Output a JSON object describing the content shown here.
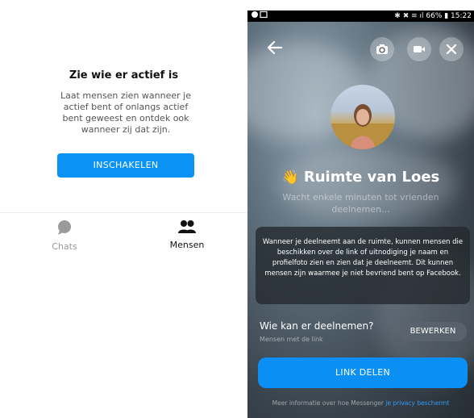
{
  "left_panel": {
    "title": "Zie wie er actief is",
    "description": "Laat mensen zien wanneer je actief bent of onlangs actief bent geweest en ontdek ook wanneer zij dat zijn.",
    "enable_button": "INSCHAKELEN",
    "tabs": [
      {
        "label": "Chats",
        "icon": "chat-bubble-icon",
        "active": false
      },
      {
        "label": "Mensen",
        "icon": "people-icon",
        "active": true
      }
    ]
  },
  "status_bar": {
    "left_icons": [
      "spotify-icon",
      "image-icon"
    ],
    "right_text": "66% ▮ 15:22",
    "right_icons": [
      "bluetooth-icon",
      "mute-icon",
      "wifi-icon",
      "signal-icon",
      "battery-icon"
    ]
  },
  "room": {
    "title": "Ruimte van Loes",
    "title_emoji": "👋",
    "subtitle": "Wacht enkele minuten tot vrienden deelnemen...",
    "info_text": "Wanneer je deelneemt aan de ruimte, kunnen mensen die beschikken over de link of uitnodiging je naam en profielfoto zien en zien dat je deelneemt. Dit kunnen mensen zijn waarmee je niet bevriend bent op Facebook.",
    "who_title": "Wie kan er deelnemen?",
    "who_sub": "Mensen met de link",
    "edit_button": "BEWERKEN",
    "share_button": "LINK DELEN",
    "footer_text": "Meer informatie over hoe Messenger ",
    "footer_link": "je privacy beschermt"
  },
  "colors": {
    "accent": "#0a93f5",
    "link": "#2e9cf5"
  }
}
